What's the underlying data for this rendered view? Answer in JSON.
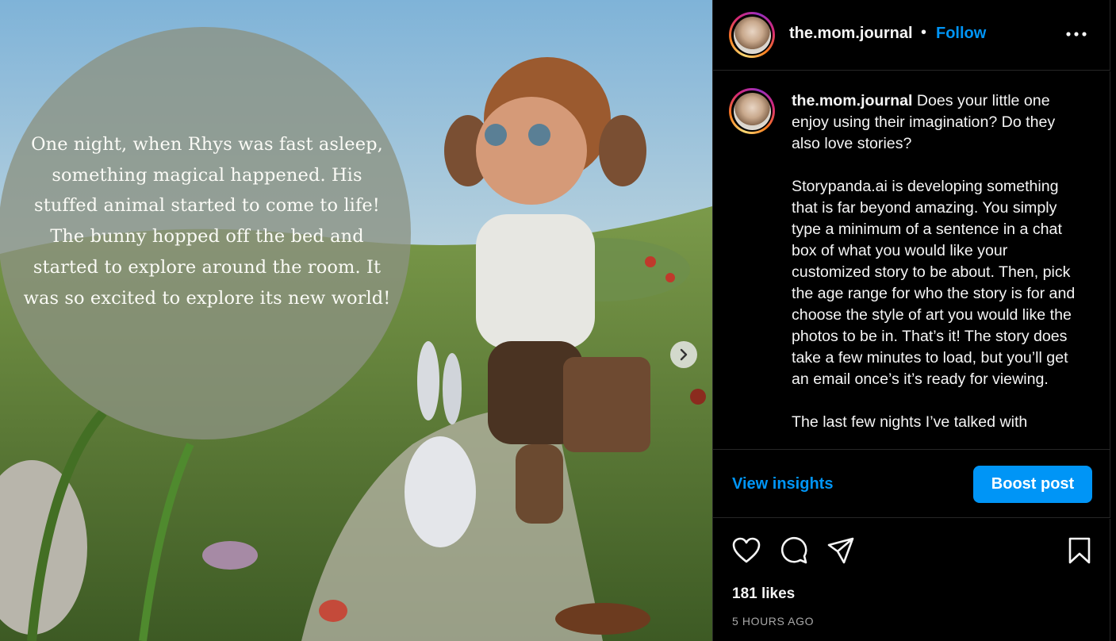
{
  "media": {
    "caption": "One night, when Rhys was fast asleep, something magical happened. His stuffed animal started to come to life! The bunny hopped off the bed and started to explore around the room. It was so excited to explore its new world!",
    "next_icon": "chevron-right-icon"
  },
  "header": {
    "username": "the.mom.journal",
    "separator": "•",
    "follow_label": "Follow",
    "more_icon": "more-horizontal-icon"
  },
  "post": {
    "author": "the.mom.journal",
    "caption": " Does your little one enjoy using their imagination? Do they also love stories?\n\nStorypanda.ai is developing something that is far beyond amazing. You simply type a minimum of a sentence in a chat box of what you would like your customized story to be about. Then, pick the age range for who the story is for and choose the style of art you would like the photos to be in. That’s it! The story does take a few minutes to load, but you’ll get an email once’s it’s ready for viewing.\n\nThe last few nights I’ve talked with"
  },
  "insights": {
    "view_label": "View insights",
    "boost_label": "Boost post"
  },
  "actions": {
    "icons": [
      "heart-icon",
      "comment-icon",
      "share-icon",
      "bookmark-icon"
    ],
    "likes": "181 likes",
    "time": "5 HOURS AGO"
  },
  "colors": {
    "accent": "#0095f6",
    "background": "#000000",
    "text": "#f5f5f5",
    "muted": "#a8a8a8"
  }
}
